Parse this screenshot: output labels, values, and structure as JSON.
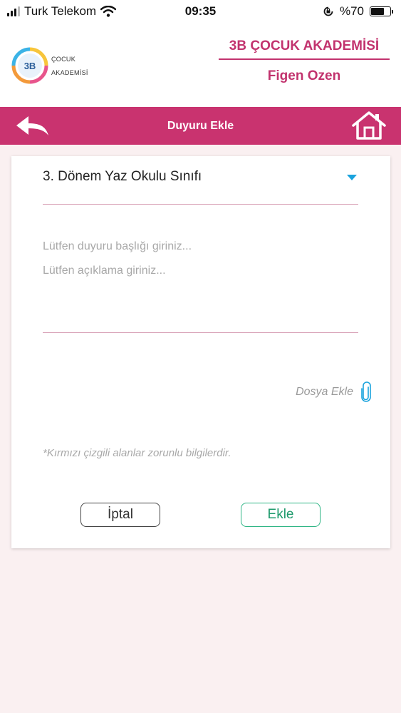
{
  "status_bar": {
    "carrier": "Turk Telekom",
    "time": "09:35",
    "battery_label": "%70",
    "battery_level": 0.7
  },
  "header": {
    "logo_mark": "3B",
    "logo_line1": "ÇOCUK",
    "logo_line2": "AKADEMİSİ",
    "brand_title": "3B ÇOCUK AKADEMİSİ",
    "user_name": "Figen Ozen"
  },
  "nav": {
    "title": "Duyuru Ekle",
    "back_icon": "back-arrow-icon",
    "home_icon": "home-icon"
  },
  "form": {
    "class_select_value": "3. Dönem Yaz Okulu Sınıfı",
    "title_placeholder": "Lütfen duyuru başlığı giriniz...",
    "description_placeholder": "Lütfen açıklama giriniz...",
    "attach_label": "Dosya Ekle",
    "required_note": "*Kırmızı çizgili alanlar zorunlu bilgilerdir.",
    "cancel_label": "İptal",
    "add_label": "Ekle"
  },
  "colors": {
    "brand": "#c9336f",
    "accent_blue": "#1aa3dd",
    "accent_green": "#2fb585",
    "background": "#faf0f1"
  }
}
